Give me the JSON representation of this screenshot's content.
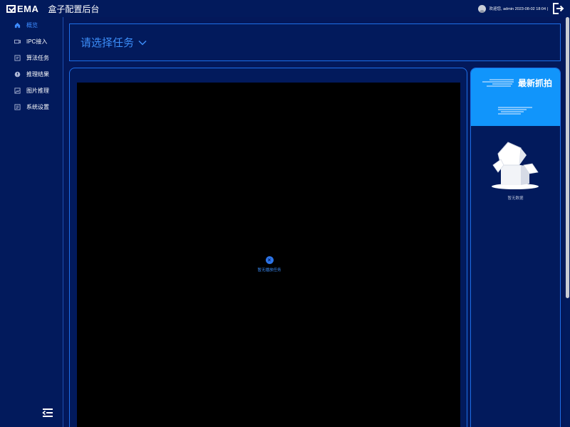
{
  "header": {
    "logo_text": "EMA",
    "app_title": "盒子配置后台",
    "welcome_text": "欢迎您, admin 2023-08-02 18:04 |",
    "logout_icon": "logout-icon"
  },
  "sidebar": {
    "items": [
      {
        "label": "概览",
        "icon": "home-icon",
        "active": true
      },
      {
        "label": "IPC接入",
        "icon": "camera-icon",
        "active": false
      },
      {
        "label": "算法任务",
        "icon": "task-icon",
        "active": false
      },
      {
        "label": "推理结果",
        "icon": "result-icon",
        "active": false
      },
      {
        "label": "图片推理",
        "icon": "image-icon",
        "active": false
      },
      {
        "label": "系统设置",
        "icon": "settings-icon",
        "active": false
      }
    ],
    "collapse_icon": "menu-collapse-icon"
  },
  "task_select": {
    "placeholder": "请选择任务"
  },
  "video": {
    "empty_text": "暂无播放任务"
  },
  "capture": {
    "title": "最新抓拍",
    "empty_text": "暂无数据"
  },
  "colors": {
    "background": "#03185a",
    "accent": "#3c8df8",
    "panel_border": "#1e6fe8",
    "capture_header": "#1195fb"
  }
}
